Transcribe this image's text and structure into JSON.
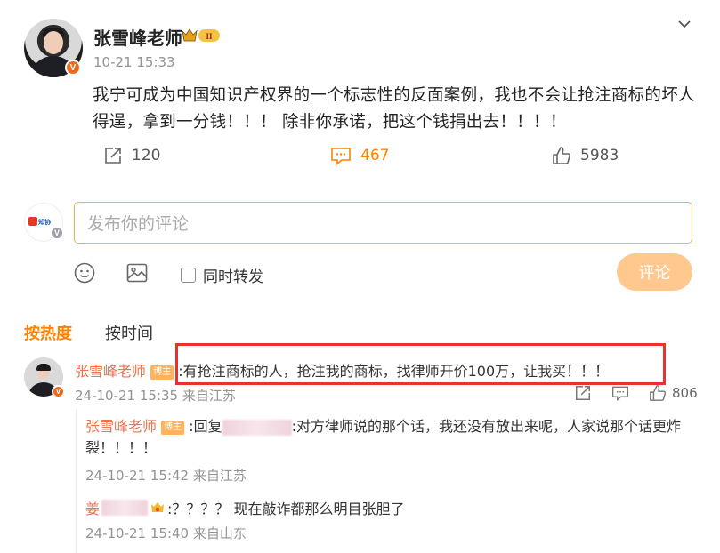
{
  "post": {
    "author": "张雪峰老师",
    "time": "10-21 15:33",
    "text": "我宁可成为中国知识产权界的一个标志性的反面案例，我也不会让抢注商标的坏人得逞，拿到一分钱！！！ 除非你承诺，把这个钱捐出去！！！！",
    "reposts": "120",
    "comments": "467",
    "likes": "5983",
    "verified_badge": "V",
    "level_badge": "II"
  },
  "composer": {
    "placeholder": "发布你的评论",
    "repost_label": "同时转发",
    "submit_label": "评论",
    "tools": [
      "emoji-icon",
      "image-icon"
    ]
  },
  "sort": {
    "hot": "按热度",
    "time": "按时间"
  },
  "comment": {
    "author": "张雪峰老师",
    "tag": "博主",
    "text": ":有抢注商标的人，抢注我的商标，找律师开价100万，让我买！！！",
    "meta": "24-10-21 15:35 来自江苏",
    "likes": "806"
  },
  "replies": [
    {
      "author": "张雪峰老师",
      "tag": "博主",
      "prefix": ":回复",
      "text": ":对方律师说的那个话，我还没有放出来呢，人家说那个话更炸裂！！！！",
      "meta": "24-10-21 15:42 来自江苏"
    },
    {
      "author_initial": "姜",
      "text": ":？？？？ 现在敲诈都那么明目张胆了",
      "meta": "24-10-21 15:40 来自山东"
    }
  ],
  "colors": {
    "accent": "#ff8200",
    "name": "#eb7350",
    "highlight": "#e8322d",
    "submit_disabled": "#ffc88f"
  }
}
